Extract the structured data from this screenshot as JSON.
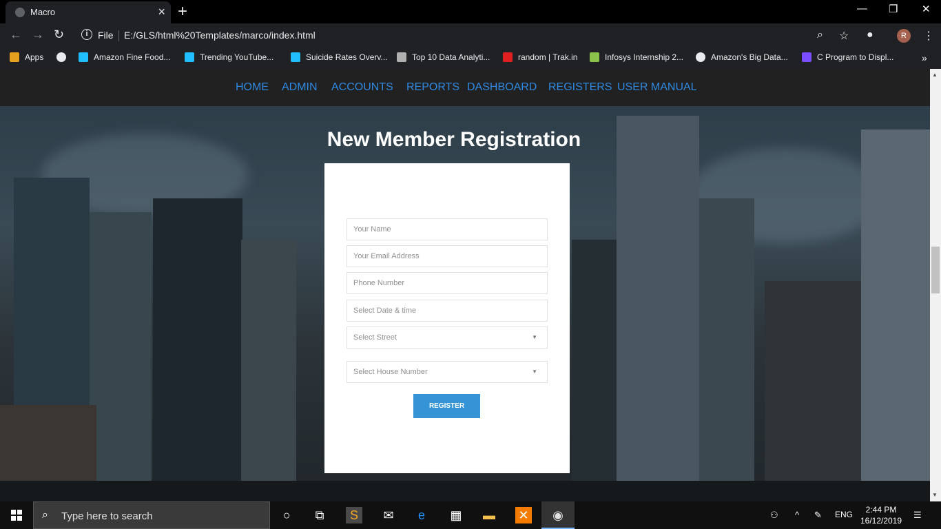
{
  "browser": {
    "tab_title": "Macro",
    "new_tab": "+",
    "file_label": "File",
    "url": "E:/GLS/html%20Templates/marco/index.html",
    "profile_initial": "R"
  },
  "bookmarks": [
    {
      "label": "Apps",
      "color": "#e5a020"
    },
    {
      "label": "",
      "color": "#e8eaed"
    },
    {
      "label": "Amazon Fine Food...",
      "color": "#20beff"
    },
    {
      "label": "Trending YouTube...",
      "color": "#20beff"
    },
    {
      "label": "Suicide Rates Overv...",
      "color": "#20beff"
    },
    {
      "label": "Top 10 Data Analyti...",
      "color": "#b0b0b0"
    },
    {
      "label": "random | Trak.in",
      "color": "#e02020"
    },
    {
      "label": "Infosys Internship 2...",
      "color": "#8bc34a"
    },
    {
      "label": "Amazon's Big Data...",
      "color": "#e8eaed"
    },
    {
      "label": "C Program to Displ...",
      "color": "#7c4dff"
    }
  ],
  "nav": [
    "HOME",
    "ADMIN",
    "ACCOUNTS",
    "REPORTS",
    "DASHBOARD",
    "REGISTERS",
    "USER MANUAL"
  ],
  "page": {
    "heading": "New Member Registration"
  },
  "form": {
    "name_placeholder": "Your Name",
    "email_placeholder": "Your Email Address",
    "phone_placeholder": "Phone Number",
    "date_placeholder": "Select Date & time",
    "street_select": "Select Street",
    "house_select": "Select House Number",
    "register_label": "REGISTER"
  },
  "taskbar": {
    "search_placeholder": "Type here to search",
    "lang": "ENG",
    "time": "2:44 PM",
    "date": "16/12/2019"
  },
  "colors": {
    "nav_link": "#2f8ae3",
    "register_button": "#3494d6"
  }
}
